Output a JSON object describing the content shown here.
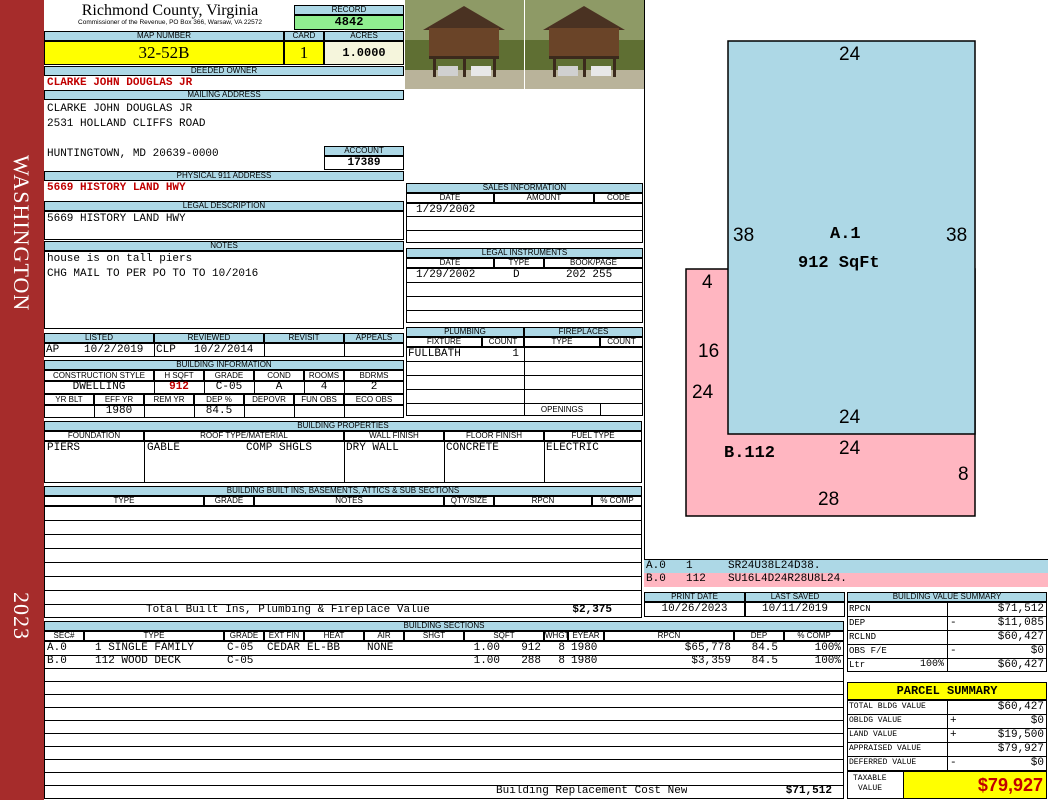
{
  "side_band": {
    "county": "WASHINGTON",
    "year": "2023"
  },
  "header": {
    "title": "Richmond County, Virginia",
    "subtitle": "Commissioner of the Revenue, PO Box 366, Warsaw, VA 22572",
    "record_label": "RECORD",
    "record": "4842"
  },
  "parcel": {
    "map_number_label": "MAP NUMBER",
    "map_number": "32-52B",
    "card_label": "CARD",
    "card": "1",
    "acres_label": "ACRES",
    "acres": "1.0000"
  },
  "owner": {
    "deeded_owner_label": "DEEDED OWNER",
    "deeded_owner": "CLARKE JOHN DOUGLAS JR",
    "mailing_address_label": "MAILING ADDRESS",
    "mailing_lines": [
      "CLARKE JOHN DOUGLAS JR",
      "2531 HOLLAND CLIFFS ROAD",
      "",
      "HUNTINGTOWN, MD 20639-0000"
    ],
    "account_label": "ACCOUNT",
    "account": "17389"
  },
  "address": {
    "label": "PHYSICAL 911 ADDRESS",
    "value": "5669 HISTORY LAND HWY"
  },
  "legal": {
    "label": "LEGAL DESCRIPTION",
    "value": "5669 HISTORY LAND HWY"
  },
  "notes": {
    "label": "NOTES",
    "lines": [
      "house is on tall piers",
      "CHG MAIL TO PER PO TO TO 10/2016"
    ]
  },
  "review": {
    "listed_label": "LISTED",
    "reviewed_label": "REVIEWED",
    "revisit_label": "REVISIT",
    "appeals_label": "APPEALS",
    "listed_by": "AP",
    "listed_date": "10/2/2019",
    "reviewed_by": "CLP",
    "reviewed_date": "10/2/2014"
  },
  "building_info": {
    "label": "BUILDING INFORMATION",
    "headers": [
      "CONSTRUCTION STYLE",
      "H SQFT",
      "GRADE",
      "COND",
      "ROOMS",
      "BDRMS"
    ],
    "values": [
      "DWELLING",
      "912",
      "C-05",
      "A",
      "4",
      "2"
    ],
    "headers2": [
      "YR BLT",
      "EFF YR",
      "REM YR",
      "DEP %",
      "DEPOVR",
      "FUN OBS",
      "ECO OBS"
    ],
    "values2": [
      "",
      "1980",
      "",
      "84.5",
      "",
      "",
      ""
    ]
  },
  "sales": {
    "label": "SALES INFORMATION",
    "headers": [
      "DATE",
      "AMOUNT",
      "CODE"
    ],
    "rows": [
      [
        "1/29/2002",
        "",
        ""
      ]
    ]
  },
  "legal_instruments": {
    "label": "LEGAL INSTRUMENTS",
    "headers": [
      "DATE",
      "TYPE",
      "BOOK/PAGE"
    ],
    "rows": [
      [
        "1/29/2002",
        "D",
        "202 255"
      ]
    ]
  },
  "plumbing": {
    "label": "PLUMBING",
    "headers": [
      "FIXTURE",
      "COUNT"
    ],
    "rows": [
      [
        "FULLBATH",
        "1"
      ]
    ]
  },
  "fireplaces": {
    "label": "FIREPLACES",
    "headers": [
      "TYPE",
      "COUNT"
    ],
    "openings_label": "OPENINGS"
  },
  "building_properties": {
    "label": "BUILDING PROPERTIES",
    "headers": [
      "FOUNDATION",
      "ROOF TYPE/MATERIAL",
      "WALL FINISH",
      "FLOOR FINISH",
      "FUEL TYPE"
    ],
    "foundation": "PIERS",
    "roof_type": "GABLE",
    "roof_material": "COMP SHGLS",
    "wall": "DRY WALL",
    "floor": "CONCRETE",
    "fuel": "ELECTRIC"
  },
  "built_ins": {
    "label": "BUILDING BUILT INS, BASEMENTS, ATTICS & SUB SECTIONS",
    "headers": [
      "TYPE",
      "GRADE",
      "NOTES",
      "QTY/SIZE",
      "RPCN",
      "% COMP"
    ],
    "total_label": "Total Built Ins, Plumbing & Fireplace Value",
    "total": "$2,375"
  },
  "dates": {
    "print_label": "PRINT DATE",
    "print_date": "10/26/2023",
    "saved_label": "LAST SAVED",
    "saved_date": "10/11/2019"
  },
  "sketch": {
    "a_label": "A.1",
    "a_area": "912 SqFt",
    "b_label": "B.112",
    "dims": {
      "a_top": "24",
      "a_left": "38",
      "a_right": "38",
      "a_bottom": "24",
      "b_top": "24",
      "b_4": "4",
      "b_16": "16",
      "b_24": "24",
      "b_8": "8",
      "b_28": "28"
    },
    "legend": [
      {
        "code": "A.0",
        "num": "1",
        "path": "SR24U38L24D38."
      },
      {
        "code": "B.0",
        "num": "112",
        "path": "SU16L4D24R28U8L24."
      }
    ]
  },
  "sections": {
    "label": "BUILDING SECTIONS",
    "headers": [
      "SEC#",
      "TYPE",
      "GRADE",
      "EXT FIN",
      "HEAT",
      "AIR",
      "SHGT",
      "SQFT",
      "WHGT",
      "EYEAR",
      "RPCN",
      "DEP",
      "% COMP"
    ],
    "rows": [
      [
        "A.0",
        "1 SINGLE FAMILY",
        "C-05",
        "CEDAR",
        "EL-BB",
        "NONE",
        "1.00",
        "912",
        "8",
        "1980",
        "$65,778",
        "84.5",
        "100%"
      ],
      [
        "B.0",
        "112 WOOD DECK",
        "C-05",
        "",
        "",
        "",
        "1.00",
        "288",
        "8",
        "1980",
        "$3,359",
        "84.5",
        "100%"
      ]
    ],
    "replacement_label": "Building Replacement Cost New",
    "replacement": "$71,512"
  },
  "value_summary": {
    "label": "BUILDING VALUE SUMMARY",
    "rows": [
      {
        "label": "RPCN",
        "sign": "",
        "pct": "",
        "value": "$71,512"
      },
      {
        "label": "DEP",
        "sign": "-",
        "pct": "",
        "value": "$11,085"
      },
      {
        "label": "RCLND",
        "sign": "",
        "pct": "",
        "value": "$60,427"
      },
      {
        "label": "OBS F/E",
        "sign": "-",
        "pct": "",
        "value": "$0"
      },
      {
        "label": "Ltr",
        "sign": "",
        "pct": "100%",
        "value": "$60,427"
      }
    ]
  },
  "parcel_summary": {
    "label": "PARCEL SUMMARY",
    "rows": [
      {
        "label": "TOTAL BLDG VALUE",
        "sign": "",
        "value": "$60,427"
      },
      {
        "label": "OBLDG VALUE",
        "sign": "+",
        "value": "$0"
      },
      {
        "label": "LAND VALUE",
        "sign": "+",
        "value": "$19,500"
      },
      {
        "label": "APPRAISED VALUE",
        "sign": "",
        "value": "$79,927"
      },
      {
        "label": "DEFERRED VALUE",
        "sign": "-",
        "value": "$0"
      }
    ],
    "taxable_label_1": "TAXABLE",
    "taxable_label_2": "VALUE",
    "taxable": "$79,927"
  },
  "colors": {
    "band": "#a62c2b",
    "header_fill": "#add8e6",
    "record_fill": "#90ee90",
    "highlight": "#ffff00",
    "sketch_a": "#add8e6",
    "sketch_b": "#ffb6c1",
    "red_text": "#c00000"
  }
}
